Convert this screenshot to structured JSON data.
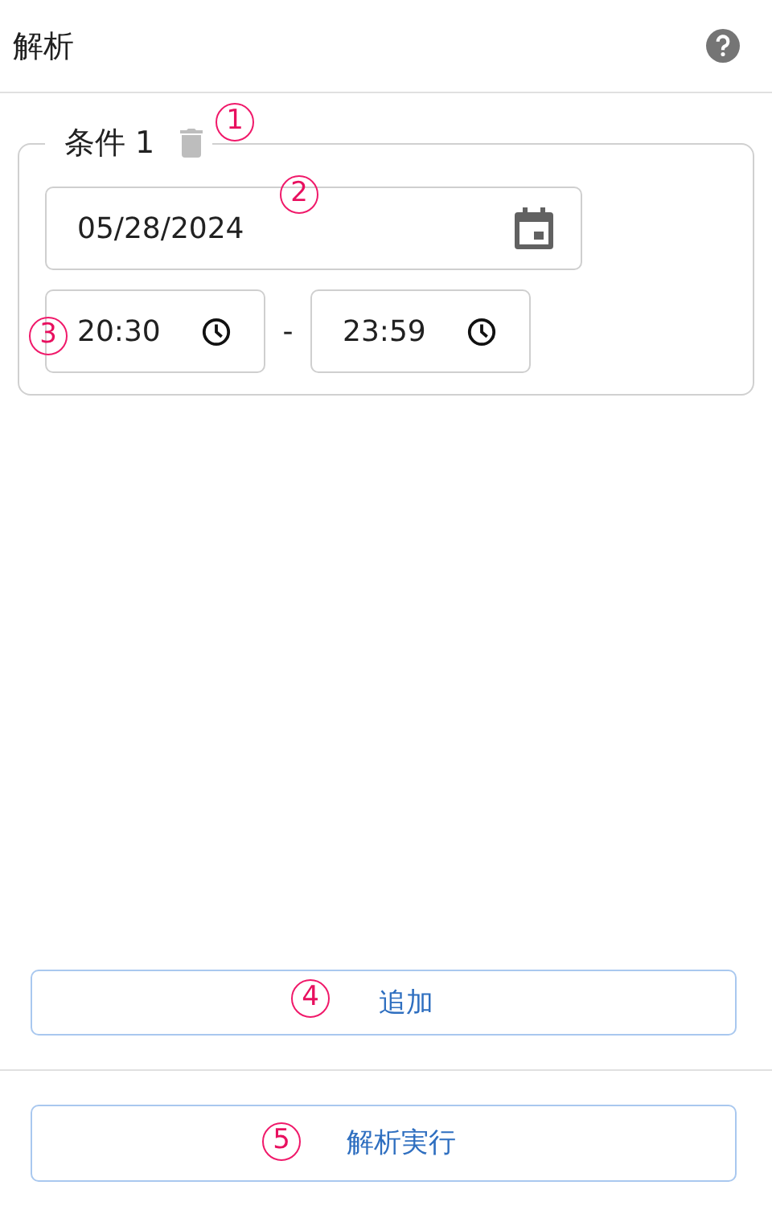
{
  "header": {
    "title": "解析"
  },
  "condition": {
    "legend": "条件 1",
    "date": "05/28/2024",
    "start_time": "20:30",
    "separator": "-",
    "end_time": "23:59"
  },
  "buttons": [
    {
      "label": "追加"
    },
    {
      "label": "解析実行"
    }
  ],
  "callouts": [
    "1",
    "2",
    "3",
    "4",
    "5"
  ]
}
